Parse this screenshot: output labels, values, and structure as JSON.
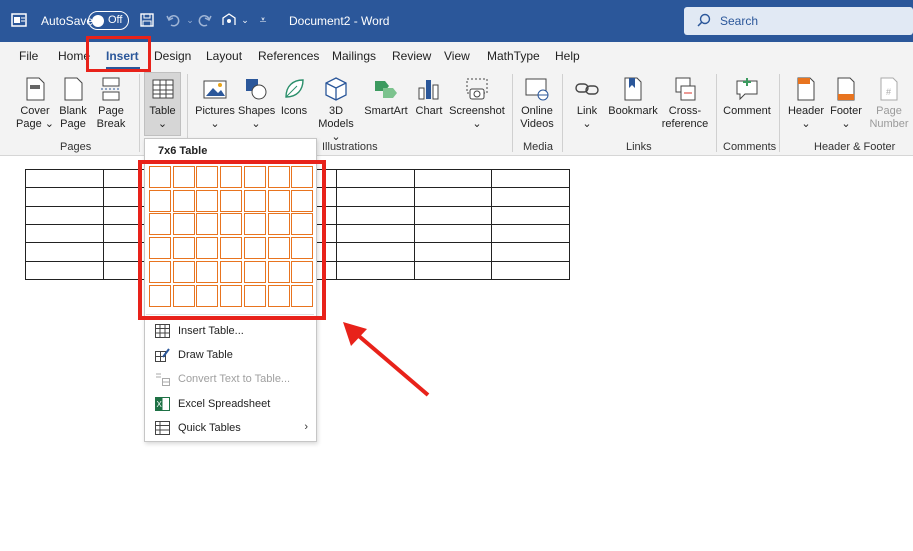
{
  "titlebar": {
    "autosave_label": "AutoSave",
    "autosave_state": "Off",
    "doc_title": "Document2  -  Word",
    "search_placeholder": "Search",
    "icons": [
      "word-app-icon",
      "save-icon",
      "undo-icon",
      "redo-icon",
      "touch-mode-icon",
      "customize-qat-icon",
      "search-icon"
    ]
  },
  "tabs": [
    "File",
    "Home",
    "Insert",
    "Design",
    "Layout",
    "References",
    "Mailings",
    "Review",
    "View",
    "MathType",
    "Help"
  ],
  "active_tab": "Insert",
  "ribbon": {
    "pages": {
      "cover_page": [
        "Cover",
        "Page"
      ],
      "blank_page": [
        "Blank",
        "Page"
      ],
      "page_break": [
        "Page",
        "Break"
      ],
      "label": "Pages"
    },
    "table": {
      "label": "Table"
    },
    "illustrations": {
      "pictures": "Pictures",
      "shapes": "Shapes",
      "icons": "Icons",
      "models_3d": [
        "3D",
        "Models"
      ],
      "smartart": "SmartArt",
      "chart": "Chart",
      "screenshot": "Screenshot",
      "label": "Illustrations"
    },
    "media": {
      "online_videos": [
        "Online",
        "Videos"
      ],
      "label": "Media"
    },
    "links": {
      "link": "Link",
      "bookmark": "Bookmark",
      "cross_reference": [
        "Cross-",
        "reference"
      ],
      "label": "Links"
    },
    "comments": {
      "comment": "Comment",
      "label": "Comments"
    },
    "header_footer": {
      "header": "Header",
      "footer": "Footer",
      "page_number": [
        "Page",
        "Number"
      ],
      "label": "Header & Footer"
    }
  },
  "table_dropdown": {
    "title": "7x6 Table",
    "grid_cols": 7,
    "grid_rows": 6,
    "items": [
      {
        "label": "Insert Table...",
        "icon": "insert-table-icon",
        "disabled": false
      },
      {
        "label": "Draw Table",
        "icon": "draw-table-icon",
        "disabled": false
      },
      {
        "label": "Convert Text to Table...",
        "icon": "convert-text-icon",
        "disabled": true
      },
      {
        "label": "Excel Spreadsheet",
        "icon": "excel-icon",
        "disabled": false
      },
      {
        "label": "Quick Tables",
        "icon": "quick-tables-icon",
        "disabled": false,
        "submenu": true
      }
    ]
  },
  "document_table": {
    "rows": 6,
    "cols": 7
  },
  "colors": {
    "title_bar": "#2b579a",
    "highlight_red": "#e8221a",
    "grid_orange": "#e8741f"
  }
}
